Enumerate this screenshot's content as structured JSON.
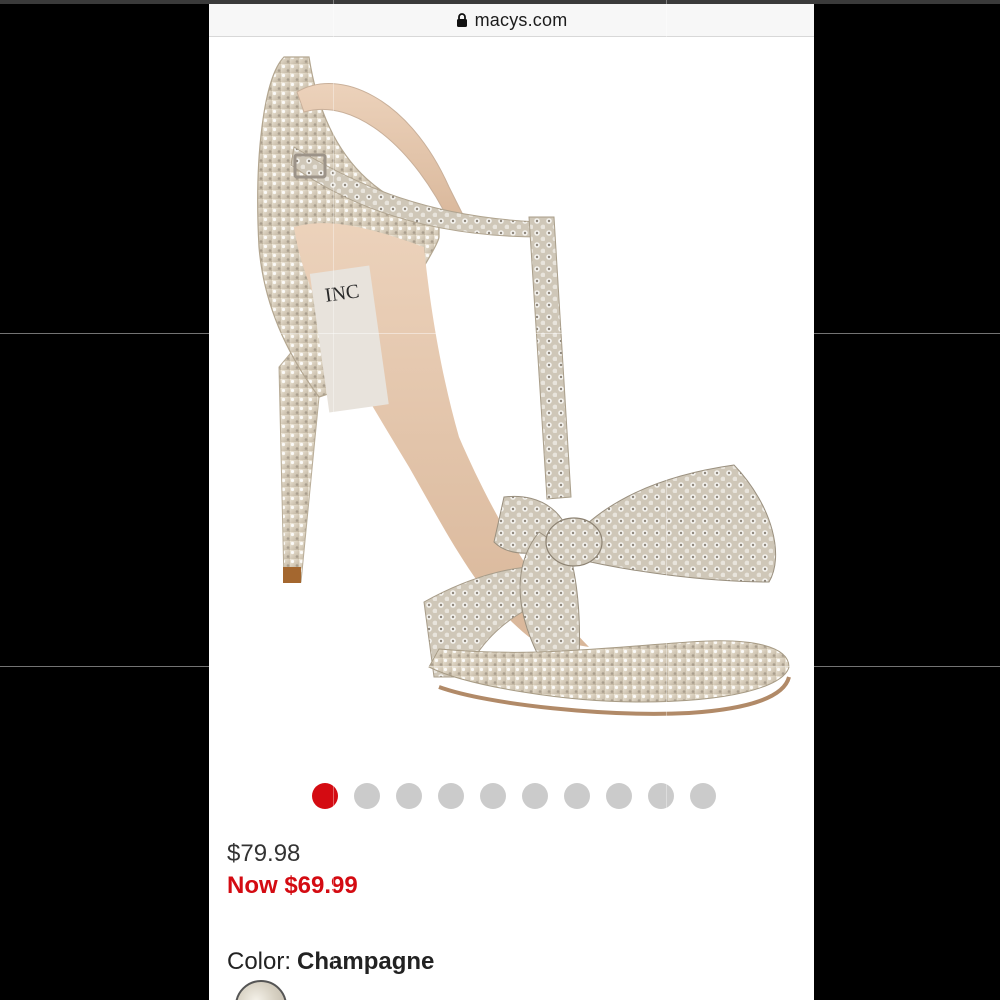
{
  "browser": {
    "url": "macys.com"
  },
  "product": {
    "image_description_icon": "sandal-image",
    "carousel": {
      "total": 10,
      "active_index": 0
    },
    "price_original": "$79.98",
    "price_sale": "Now $69.99",
    "color_label": "Color:",
    "color_value": "Champagne"
  },
  "colors": {
    "sale_red": "#d40b12",
    "dot_inactive": "#cbcbcb"
  }
}
